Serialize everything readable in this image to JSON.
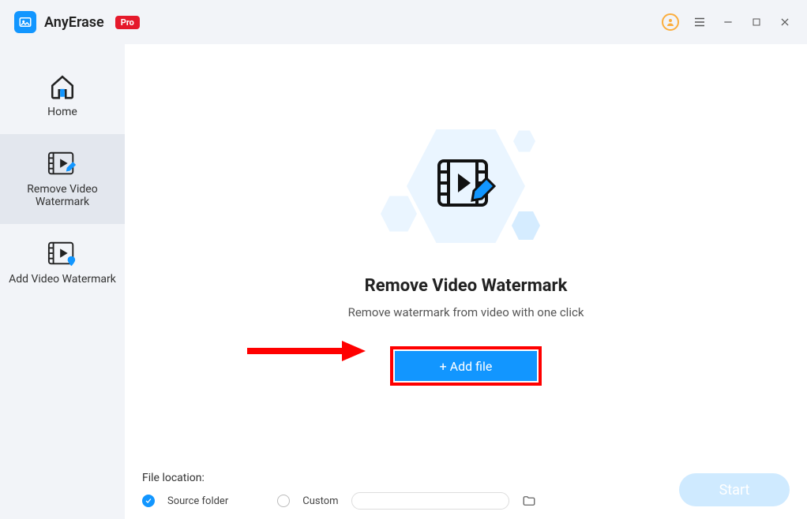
{
  "app": {
    "name": "AnyErase",
    "badge": "Pro"
  },
  "sidebar": {
    "items": [
      {
        "label": "Home"
      },
      {
        "label": "Remove Video Watermark"
      },
      {
        "label": "Add Video Watermark"
      }
    ]
  },
  "hero": {
    "title": "Remove Video Watermark",
    "subtitle": "Remove watermark from video with one click",
    "add_file_label": "+ Add file"
  },
  "bottom": {
    "file_location_label": "File location:",
    "source_folder_label": "Source folder",
    "custom_label": "Custom",
    "start_label": "Start"
  }
}
